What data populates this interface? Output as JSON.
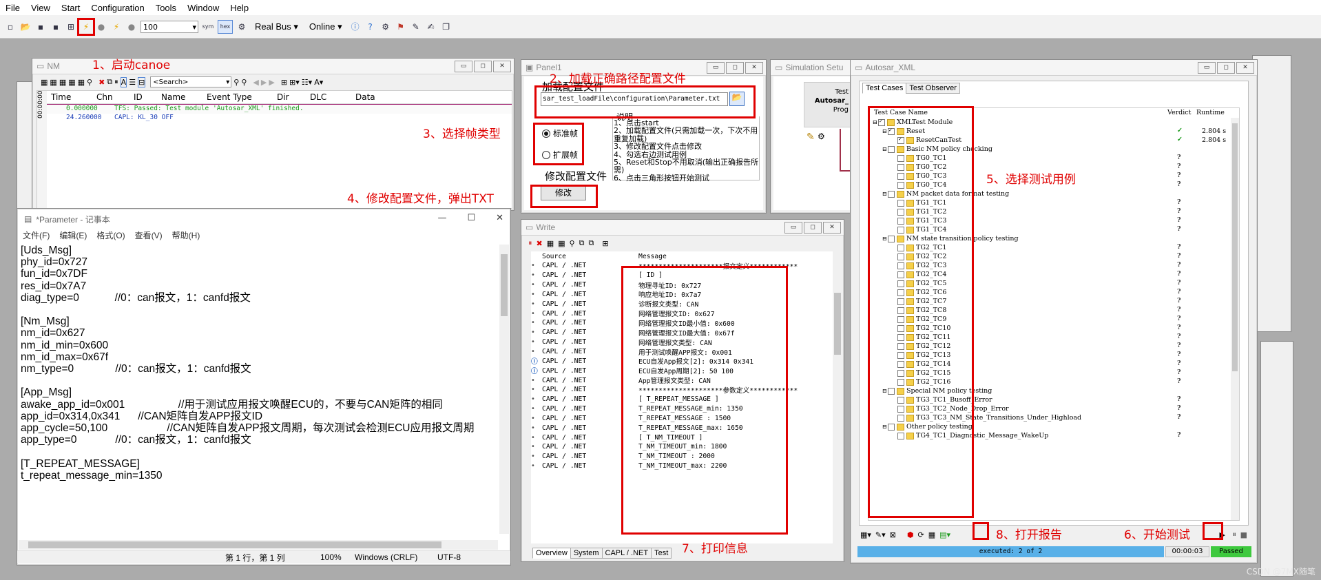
{
  "menu": [
    "File",
    "View",
    "Start",
    "Configuration",
    "Tools",
    "Window",
    "Help"
  ],
  "toolbar": {
    "zoom_value": "100",
    "bus_mode": "Real Bus",
    "online_mode": "Online",
    "sym_label": "sym",
    "hex_label": "hex"
  },
  "annotations": {
    "a1": "1、启动canoe",
    "a2": "2、加载正确路径配置文件",
    "a3": "3、选择帧类型",
    "a4": "4、修改配置文件，弹出TXT",
    "a5": "5、选择测试用例",
    "a6": "6、开始测试",
    "a7": "7、打印信息",
    "a8": "8、打开报告"
  },
  "nm_window": {
    "title": "NM",
    "search_placeholder": "<Search>",
    "columns": [
      "Time",
      "Chn",
      "ID",
      "Name",
      "Event Type",
      "Dir",
      "DLC",
      "Data"
    ],
    "side_label": "00:00:00",
    "rows": [
      {
        "time": "0.000000",
        "text": "TFS: Passed: Test module 'Autosar_XML' finished.",
        "color": "#1a9a1a"
      },
      {
        "time": "24.260000",
        "text": "CAPL: KL_30 OFF",
        "color": "#1c3fb8"
      }
    ]
  },
  "panel1": {
    "title": "Panel1",
    "load_label": "加载配置文件",
    "path_value": "sar_test_loadFile\\configuration\\Parameter.txt",
    "radio_std": "标准帧",
    "radio_ext": "扩展帧",
    "modify_label": "修改配置文件",
    "modify_button": "修改",
    "notes_title": "说明",
    "notes": "1、点击start\n2、加载配置文件(只需加载一次，下次不用重复加载)\n3、修改配置文件点击修改\n4、勾选右边测试用例\n5、Reset和Stop不用取消(输出正确报告所需)\n6、点击三角形按钮开始测试"
  },
  "sim_window": {
    "title": "Simulation Setu",
    "node_test": "Test",
    "node_name": "Autosar_",
    "node_prog": "Prog"
  },
  "notepad": {
    "title": "*Parameter - 记事本",
    "menu": [
      "文件(F)",
      "编辑(E)",
      "格式(O)",
      "查看(V)",
      "帮助(H)"
    ],
    "content": "[Uds_Msg]\nphy_id=0x727\nfun_id=0x7DF\nres_id=0x7A7\ndiag_type=0            //0：can报文，1：canfd报文\n\n[Nm_Msg]\nnm_id=0x627\nnm_id_min=0x600\nnm_id_max=0x67f\nnm_type=0              //0：can报文，1：canfd报文\n\n[App_Msg]\nawake_app_id=0x001                  //用于测试应用报文唤醒ECU的，不要与CAN矩阵的相同\napp_id=0x314,0x341      //CAN矩阵自发APP报文ID\napp_cycle=50,100                    //CAN矩阵自发APP报文周期，每次测试会检测ECU应用报文周期\napp_type=0             //0：can报文，1：canfd报文\n\n[T_REPEAT_MESSAGE]\nt_repeat_message_min=1350",
    "status_pos": "第 1 行，第 1 列",
    "status_zoom": "100%",
    "status_eol": "Windows (CRLF)",
    "status_enc": "UTF-8"
  },
  "write_window": {
    "title": "Write",
    "col_source": "Source",
    "col_message": "Message",
    "rows": [
      {
        "src": "CAPL / .NET",
        "msg": "*********************报文定义************",
        "info": false
      },
      {
        "src": "CAPL / .NET",
        "msg": "[ ID ]",
        "info": false
      },
      {
        "src": "CAPL / .NET",
        "msg": "物理寻址ID: 0x727",
        "info": false
      },
      {
        "src": "CAPL / .NET",
        "msg": "响应地址ID: 0x7a7",
        "info": false
      },
      {
        "src": "CAPL / .NET",
        "msg": "诊断报文类型: CAN",
        "info": false
      },
      {
        "src": "CAPL / .NET",
        "msg": "网络管理报文ID: 0x627",
        "info": false
      },
      {
        "src": "CAPL / .NET",
        "msg": "网络管理报文ID最小值: 0x600",
        "info": false
      },
      {
        "src": "CAPL / .NET",
        "msg": "网络管理报文ID最大值: 0x67f",
        "info": false
      },
      {
        "src": "CAPL / .NET",
        "msg": "网络管理报文类型: CAN",
        "info": false
      },
      {
        "src": "CAPL / .NET",
        "msg": "用于测试唤醒APP报文: 0x001",
        "info": false
      },
      {
        "src": "CAPL / .NET",
        "msg": "ECU自发App报文[2]: 0x314 0x341",
        "info": true
      },
      {
        "src": "CAPL / .NET",
        "msg": "ECU自发App周期[2]:    50    100",
        "info": true
      },
      {
        "src": "CAPL / .NET",
        "msg": "App管理报文类型: CAN",
        "info": false
      },
      {
        "src": "CAPL / .NET",
        "msg": "*********************参数定义************",
        "info": false
      },
      {
        "src": "CAPL / .NET",
        "msg": "[ T_REPEAT_MESSAGE ]",
        "info": false
      },
      {
        "src": "CAPL / .NET",
        "msg": "T_REPEAT_MESSAGE_min: 1350",
        "info": false
      },
      {
        "src": "CAPL / .NET",
        "msg": "T_REPEAT_MESSAGE    : 1500",
        "info": false
      },
      {
        "src": "CAPL / .NET",
        "msg": "T_REPEAT_MESSAGE_max: 1650",
        "info": false
      },
      {
        "src": "CAPL / .NET",
        "msg": "[ T_NM_TIMEOUT ]",
        "info": false
      },
      {
        "src": "CAPL / .NET",
        "msg": "T_NM_TIMEOUT_min: 1800",
        "info": false
      },
      {
        "src": "CAPL / .NET",
        "msg": "T_NM_TIMEOUT    : 2000",
        "info": false
      },
      {
        "src": "CAPL / .NET",
        "msg": "T_NM_TIMEOUT_max: 2200",
        "info": false
      }
    ],
    "tabs": [
      "Overview",
      "System",
      "CAPL / .NET",
      "Test"
    ]
  },
  "xml_window": {
    "title": "Autosar_XML",
    "tabs": [
      "Test Cases",
      "Test Observer"
    ],
    "col_name": "Test Case Name",
    "col_verdict": "Verdict",
    "col_runtime": "Runtime",
    "status_text": "executed: 2 of 2",
    "elapsed": "00:00:03",
    "result": "Passed",
    "items": [
      {
        "level": 0,
        "name": "XMLTest Module",
        "kind": "module",
        "verdict": "",
        "runtime": ""
      },
      {
        "level": 1,
        "name": "Reset",
        "kind": "group",
        "verdict": "pass",
        "runtime": "2.804 s"
      },
      {
        "level": 2,
        "name": "ResetCanTest",
        "kind": "case",
        "verdict": "pass",
        "runtime": "2.804 s"
      },
      {
        "level": 1,
        "name": "Basic NM policy checking",
        "kind": "group",
        "verdict": "",
        "runtime": ""
      },
      {
        "level": 2,
        "name": "TG0_TC1",
        "kind": "case",
        "verdict": "?",
        "runtime": ""
      },
      {
        "level": 2,
        "name": "TG0_TC2",
        "kind": "case",
        "verdict": "?",
        "runtime": ""
      },
      {
        "level": 2,
        "name": "TG0_TC3",
        "kind": "case",
        "verdict": "?",
        "runtime": ""
      },
      {
        "level": 2,
        "name": "TG0_TC4",
        "kind": "case",
        "verdict": "?",
        "runtime": ""
      },
      {
        "level": 1,
        "name": "NM packet data format testing",
        "kind": "group",
        "verdict": "",
        "runtime": ""
      },
      {
        "level": 2,
        "name": "TG1_TC1",
        "kind": "case",
        "verdict": "?",
        "runtime": ""
      },
      {
        "level": 2,
        "name": "TG1_TC2",
        "kind": "case",
        "verdict": "?",
        "runtime": ""
      },
      {
        "level": 2,
        "name": "TG1_TC3",
        "kind": "case",
        "verdict": "?",
        "runtime": ""
      },
      {
        "level": 2,
        "name": "TG1_TC4",
        "kind": "case",
        "verdict": "?",
        "runtime": ""
      },
      {
        "level": 1,
        "name": "NM state transition policy testing",
        "kind": "group",
        "verdict": "",
        "runtime": ""
      },
      {
        "level": 2,
        "name": "TG2_TC1",
        "kind": "case",
        "verdict": "?",
        "runtime": ""
      },
      {
        "level": 2,
        "name": "TG2_TC2",
        "kind": "case",
        "verdict": "?",
        "runtime": ""
      },
      {
        "level": 2,
        "name": "TG2_TC3",
        "kind": "case",
        "verdict": "?",
        "runtime": ""
      },
      {
        "level": 2,
        "name": "TG2_TC4",
        "kind": "case",
        "verdict": "?",
        "runtime": ""
      },
      {
        "level": 2,
        "name": "TG2_TC5",
        "kind": "case",
        "verdict": "?",
        "runtime": ""
      },
      {
        "level": 2,
        "name": "TG2_TC6",
        "kind": "case",
        "verdict": "?",
        "runtime": ""
      },
      {
        "level": 2,
        "name": "TG2_TC7",
        "kind": "case",
        "verdict": "?",
        "runtime": ""
      },
      {
        "level": 2,
        "name": "TG2_TC8",
        "kind": "case",
        "verdict": "?",
        "runtime": ""
      },
      {
        "level": 2,
        "name": "TG2_TC9",
        "kind": "case",
        "verdict": "?",
        "runtime": ""
      },
      {
        "level": 2,
        "name": "TG2_TC10",
        "kind": "case",
        "verdict": "?",
        "runtime": ""
      },
      {
        "level": 2,
        "name": "TG2_TC11",
        "kind": "case",
        "verdict": "?",
        "runtime": ""
      },
      {
        "level": 2,
        "name": "TG2_TC12",
        "kind": "case",
        "verdict": "?",
        "runtime": ""
      },
      {
        "level": 2,
        "name": "TG2_TC13",
        "kind": "case",
        "verdict": "?",
        "runtime": ""
      },
      {
        "level": 2,
        "name": "TG2_TC14",
        "kind": "case",
        "verdict": "?",
        "runtime": ""
      },
      {
        "level": 2,
        "name": "TG2_TC15",
        "kind": "case",
        "verdict": "?",
        "runtime": ""
      },
      {
        "level": 2,
        "name": "TG2_TC16",
        "kind": "case",
        "verdict": "?",
        "runtime": ""
      },
      {
        "level": 1,
        "name": "Special NM policy testing",
        "kind": "group",
        "verdict": "",
        "runtime": ""
      },
      {
        "level": 2,
        "name": "TG3_TC1_Busoff_Error",
        "kind": "case",
        "verdict": "?",
        "runtime": ""
      },
      {
        "level": 2,
        "name": "TG3_TC2_Node_Drop_Error",
        "kind": "case",
        "verdict": "?",
        "runtime": ""
      },
      {
        "level": 2,
        "name": "TG3_TC3_NM_State_Transitions_Under_Highload",
        "kind": "case",
        "verdict": "?",
        "runtime": ""
      },
      {
        "level": 1,
        "name": "Other policy testing",
        "kind": "group",
        "verdict": "",
        "runtime": ""
      },
      {
        "level": 2,
        "name": "TG4_TC1_Diagnostic_Message_WakeUp",
        "kind": "case",
        "verdict": "?",
        "runtime": ""
      }
    ]
  },
  "watermark": "CSDN @7MX随笔"
}
